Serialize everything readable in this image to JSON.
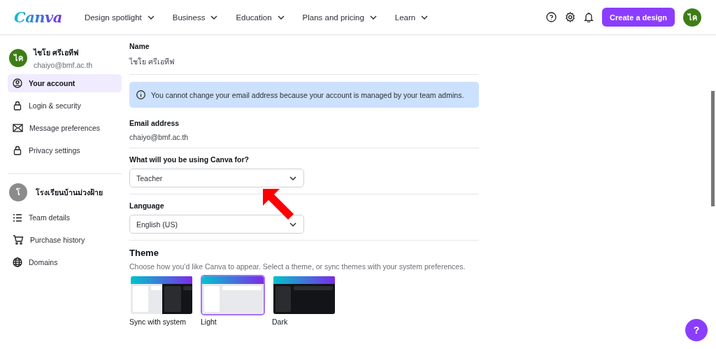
{
  "header": {
    "logo": "Canva",
    "nav": [
      {
        "label": "Design spotlight"
      },
      {
        "label": "Business"
      },
      {
        "label": "Education"
      },
      {
        "label": "Plans and pricing"
      },
      {
        "label": "Learn"
      }
    ],
    "create_button": "Create a design",
    "avatar": "ไค"
  },
  "sidebar": {
    "profile": {
      "avatar": "ไค",
      "name": "ไชโย ศรีเอทีฟ",
      "email": "chaiyo@bmf.ac.th"
    },
    "items": [
      {
        "label": "Your account",
        "selected": true
      },
      {
        "label": "Login & security",
        "selected": false
      },
      {
        "label": "Message preferences",
        "selected": false
      },
      {
        "label": "Privacy settings",
        "selected": false
      }
    ],
    "team": {
      "avatar": "โ",
      "name": "โรงเรียนบ้านม่วงฝ้าย"
    },
    "team_items": [
      {
        "label": "Team details",
        "selected": false
      },
      {
        "label": "Purchase history",
        "selected": false
      },
      {
        "label": "Domains",
        "selected": false
      }
    ]
  },
  "content": {
    "name_label": "Name",
    "name_value": "ไชโย ศรีเอทีฟ",
    "notice": "You cannot change your email address because your account is managed by your team admins.",
    "email_label": "Email address",
    "email_value": "chaiyo@bmf.ac.th",
    "usage_label": "What will you be using Canva for?",
    "usage_value": "Teacher",
    "language_label": "Language",
    "language_value": "English (US)",
    "theme_title": "Theme",
    "theme_description": "Choose how you’d like Canva to appear. Select a theme, or sync themes with your system preferences.",
    "themes": [
      {
        "kind": "sync",
        "label": "Sync with system",
        "selected": false
      },
      {
        "kind": "light",
        "label": "Light",
        "selected": true
      },
      {
        "kind": "dark",
        "label": "Dark",
        "selected": false
      }
    ]
  },
  "help_button": "?"
}
